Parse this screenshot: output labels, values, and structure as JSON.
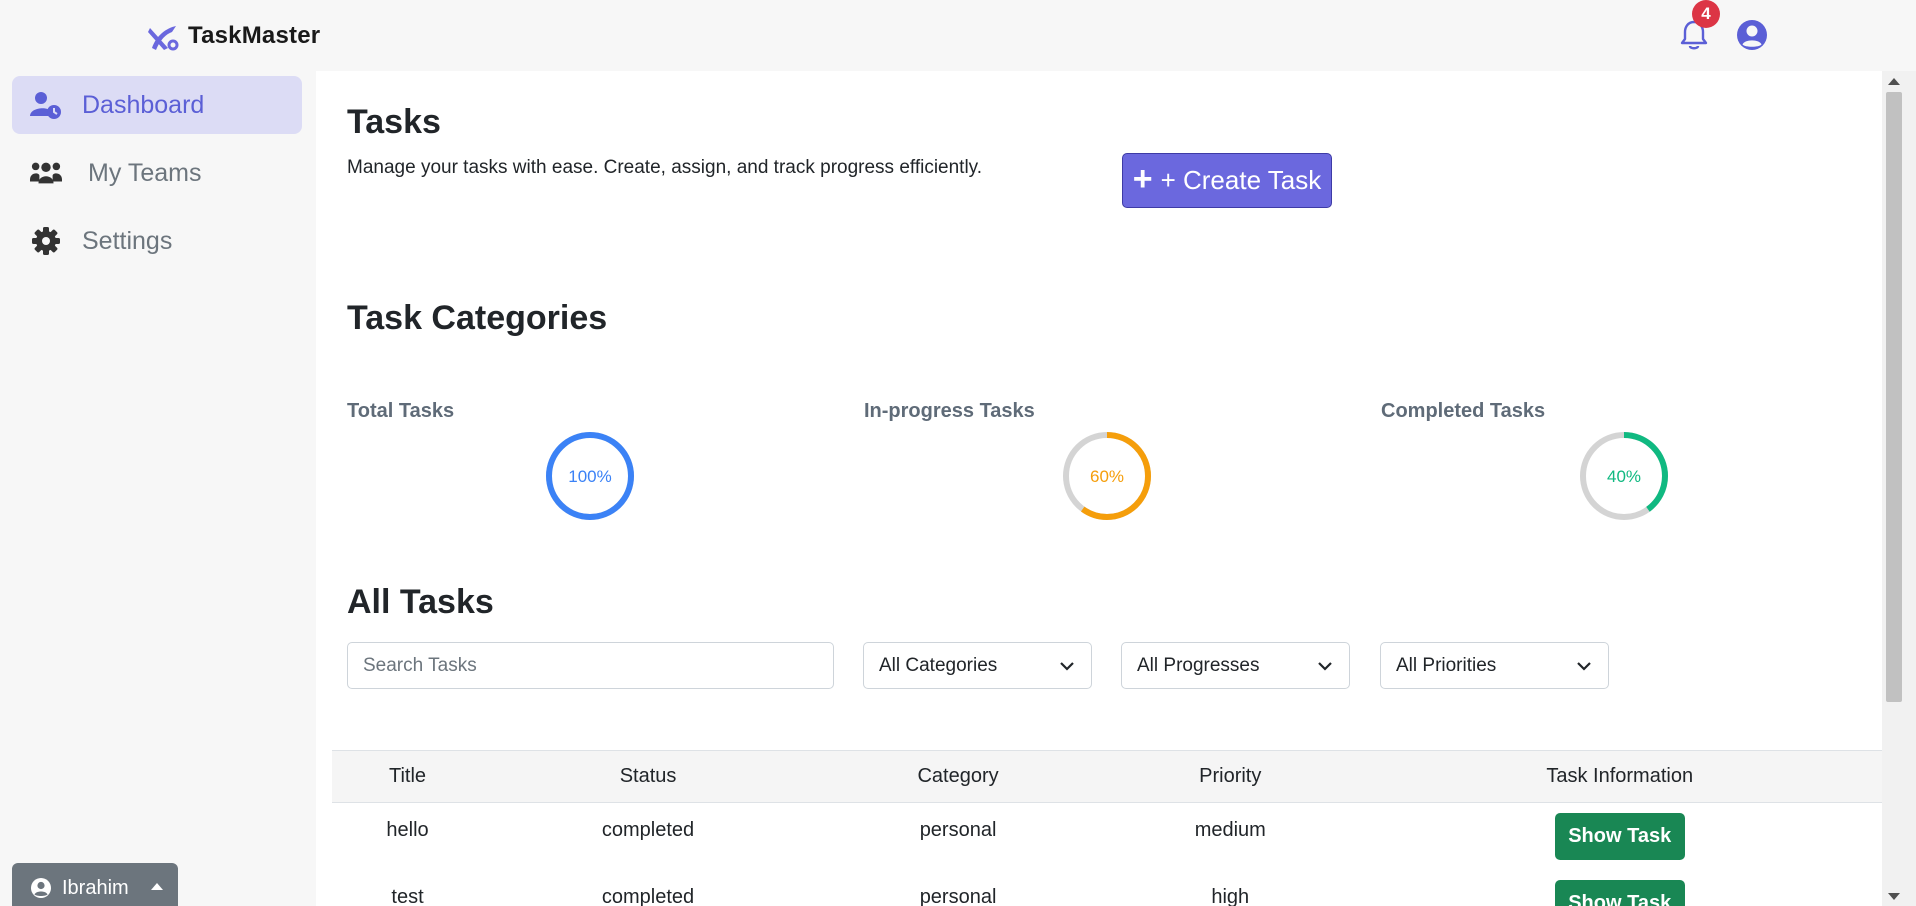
{
  "app": {
    "name": "TaskMaster"
  },
  "header": {
    "notification_count": "4"
  },
  "sidebar": {
    "items": [
      {
        "label": "Dashboard",
        "icon": "user-clock-icon",
        "active": true
      },
      {
        "label": "My Teams",
        "icon": "people-group-icon",
        "active": false
      },
      {
        "label": "Settings",
        "icon": "gear-icon",
        "active": false
      }
    ],
    "user": {
      "name": "Ibrahim"
    }
  },
  "main": {
    "title": "Tasks",
    "description": "Manage your tasks with ease. Create, assign, and track progress efficiently.",
    "create_button": "+ Create Task",
    "categories_title": "Task Categories",
    "stats": [
      {
        "label": "Total Tasks",
        "percent": 100,
        "percent_text": "100%",
        "color": "#3b82f6"
      },
      {
        "label": "In-progress Tasks",
        "percent": 60,
        "percent_text": "60%",
        "color": "#f59e0b"
      },
      {
        "label": "Completed Tasks",
        "percent": 40,
        "percent_text": "40%",
        "color": "#10b981"
      }
    ],
    "all_tasks_title": "All Tasks",
    "filters": {
      "search_placeholder": "Search Tasks",
      "category": "All Categories",
      "progress": "All Progresses",
      "priority": "All Priorities"
    },
    "table": {
      "headers": [
        "Title",
        "Status",
        "Category",
        "Priority",
        "Task Information"
      ],
      "rows": [
        {
          "title": "hello",
          "status": "completed",
          "category": "personal",
          "priority": "medium",
          "action": "Show Task"
        },
        {
          "title": "test",
          "status": "completed",
          "category": "personal",
          "priority": "high",
          "action": "Show Task"
        }
      ]
    }
  },
  "colors": {
    "accent": "#6b68de",
    "active_nav_bg": "#dcdcf5",
    "success": "#198754",
    "danger": "#dc3545",
    "ring_track": "#d4d4d4"
  }
}
